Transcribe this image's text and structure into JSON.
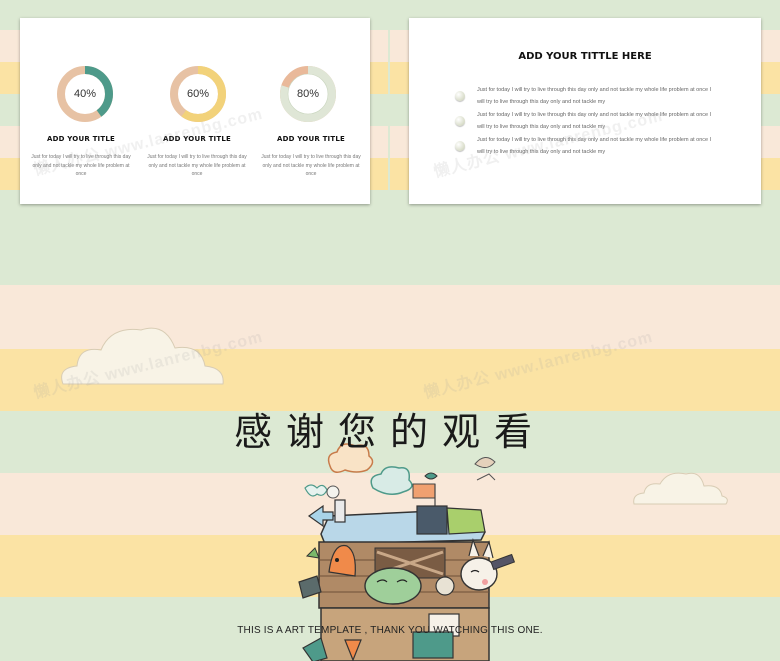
{
  "slide_left": {
    "items": [
      {
        "percent": 0.4,
        "label": "40%",
        "title": "ADD YOUR TITLE",
        "body": "Just for today I will try to live through this day only and not tackle my whole life problem at once",
        "accent": "#4e9a8a",
        "base": "#e7c2a4"
      },
      {
        "percent": 0.6,
        "label": "60%",
        "title": "ADD YOUR TITLE",
        "body": "Just for today I will try to live through this day only and not tackle my whole life problem at once",
        "accent": "#f2d27a",
        "base": "#e7c2a4"
      },
      {
        "percent": 0.8,
        "label": "80%",
        "title": "ADD YOUR TITLE",
        "body": "Just for today I will try to live through this day only and not tackle my whole life problem at once",
        "accent": "#dfe6d6",
        "base": "#e9b99a"
      }
    ]
  },
  "slide_right": {
    "title": "ADD YOUR TITTLE HERE",
    "bullets": [
      {
        "line1": "Just for today I will try to live through this day only and not tackle my whole life problem at once I",
        "line2": "will try to live through this day only and not tackle my"
      },
      {
        "line1": "Just for today I will try to live through this day only and not tackle my whole life problem at once I",
        "line2": "will try to live through this day only and not tackle my"
      },
      {
        "line1": "Just for today I will try to live through this day only and not tackle my whole life problem at once I",
        "line2": "will try to live through this day only and not tackle my"
      }
    ]
  },
  "main_slide": {
    "thanks_text": "感谢您的观看",
    "subtitle": "THIS IS A ART TEMPLATE , THANK YOU WATCHING THIS ONE."
  },
  "watermarks": [
    "懒人办公 www.lanrenbg.com",
    "懒人办公 www.lanrenbg.com",
    "懒人办公 www.lanrenbg.com",
    "懒人办公 www.lanrenbg.com"
  ],
  "colors": {
    "stripe_green": "#dce9d3",
    "stripe_peach": "#f9e8d9",
    "stripe_yellow": "#fbe3a4"
  }
}
